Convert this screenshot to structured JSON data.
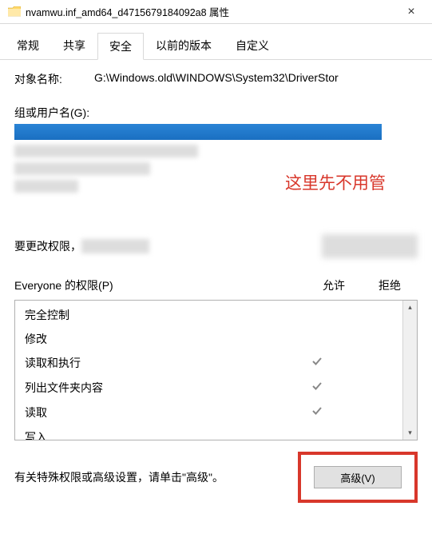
{
  "window": {
    "title": "nvamwu.inf_amd64_d4715679184092a8 属性",
    "close": "×"
  },
  "tabs": {
    "general": "常规",
    "sharing": "共享",
    "security": "安全",
    "previous": "以前的版本",
    "custom": "自定义",
    "active": "security"
  },
  "object": {
    "label": "对象名称:",
    "value": "G:\\Windows.old\\WINDOWS\\System32\\DriverStor"
  },
  "groups": {
    "label": "组或用户名(G):"
  },
  "annotation": "这里先不用管",
  "change": {
    "prefix": "要更改权限，"
  },
  "permissions": {
    "title": "Everyone 的权限(P)",
    "allow": "允许",
    "deny": "拒绝",
    "items": {
      "full": "完全控制",
      "modify": "修改",
      "readexec": "读取和执行",
      "listfolder": "列出文件夹内容",
      "read": "读取",
      "write": "写入"
    },
    "checks": {
      "full": false,
      "modify": false,
      "readexec": true,
      "listfolder": true,
      "read": true,
      "write": false
    }
  },
  "footer": {
    "text": "有关特殊权限或高级设置，请单击\"高级\"。",
    "advanced": "高级(V)"
  },
  "colors": {
    "highlight_red": "#d8372b",
    "accent_blue": "#1a6fc1"
  }
}
